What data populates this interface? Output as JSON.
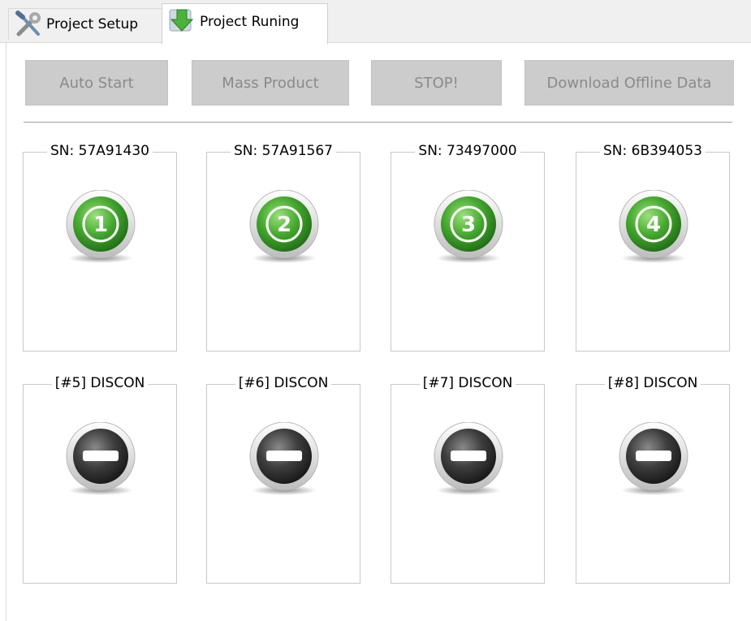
{
  "tabs": [
    {
      "label": "Project Setup",
      "icon": "tools-icon"
    },
    {
      "label": "Project Runing",
      "icon": "green-arrow-down-icon"
    }
  ],
  "buttons": {
    "auto_start": "Auto Start",
    "mass_product": "Mass Product",
    "stop": "STOP!",
    "download_offline": "Download Offline Data"
  },
  "slots": [
    {
      "title": "SN: 57A91430",
      "status": "connected",
      "number": "1",
      "icon": "green-number-icon"
    },
    {
      "title": "SN: 57A91567",
      "status": "connected",
      "number": "2",
      "icon": "green-number-icon"
    },
    {
      "title": "SN: 73497000",
      "status": "connected",
      "number": "3",
      "icon": "green-number-icon"
    },
    {
      "title": "SN: 6B394053",
      "status": "connected",
      "number": "4",
      "icon": "green-number-icon"
    },
    {
      "title": "[#5] DISCON",
      "status": "disconnected",
      "icon": "disconnected-minus-icon"
    },
    {
      "title": "[#6] DISCON",
      "status": "disconnected",
      "icon": "disconnected-minus-icon"
    },
    {
      "title": "[#7] DISCON",
      "status": "disconnected",
      "icon": "disconnected-minus-icon"
    },
    {
      "title": "[#8] DISCON",
      "status": "disconnected",
      "icon": "disconnected-minus-icon"
    }
  ],
  "colors": {
    "button_bg": "#cccccc",
    "button_text": "#8a8a8a",
    "connected_green": "#3a9a2a",
    "disconnected_gray": "#3a3a3a"
  }
}
